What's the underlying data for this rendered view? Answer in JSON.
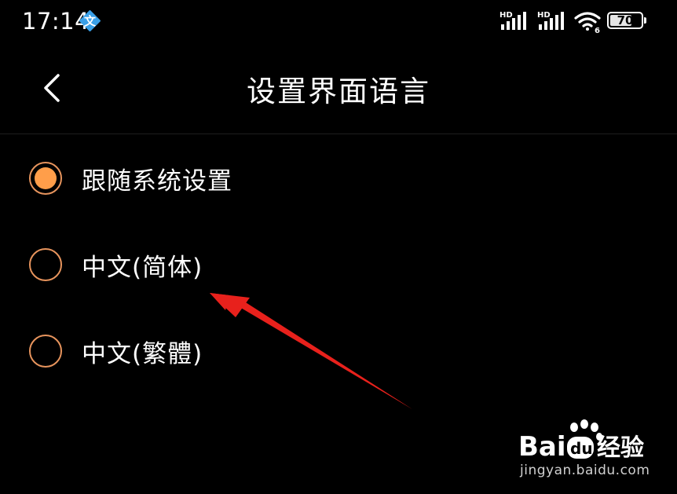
{
  "status_bar": {
    "time": "17:14",
    "input_method_glyph": "文",
    "signal_1_label": "HD",
    "signal_2_label": "HD",
    "wifi_label": "6",
    "battery_level": "70"
  },
  "header": {
    "title": "设置界面语言",
    "back_icon": "chevron-left-icon"
  },
  "options": [
    {
      "label": "跟随系统设置",
      "selected": true
    },
    {
      "label": "中文(简体)",
      "selected": false
    },
    {
      "label": "中文(繁體)",
      "selected": false
    }
  ],
  "colors": {
    "background": "#000000",
    "accent": "#ff9e4a",
    "radio_border": "#e7945d",
    "annotation_arrow": "#e8211c"
  },
  "watermark": {
    "brand": "Baidu经验",
    "url": "jingyan.baidu.com"
  }
}
